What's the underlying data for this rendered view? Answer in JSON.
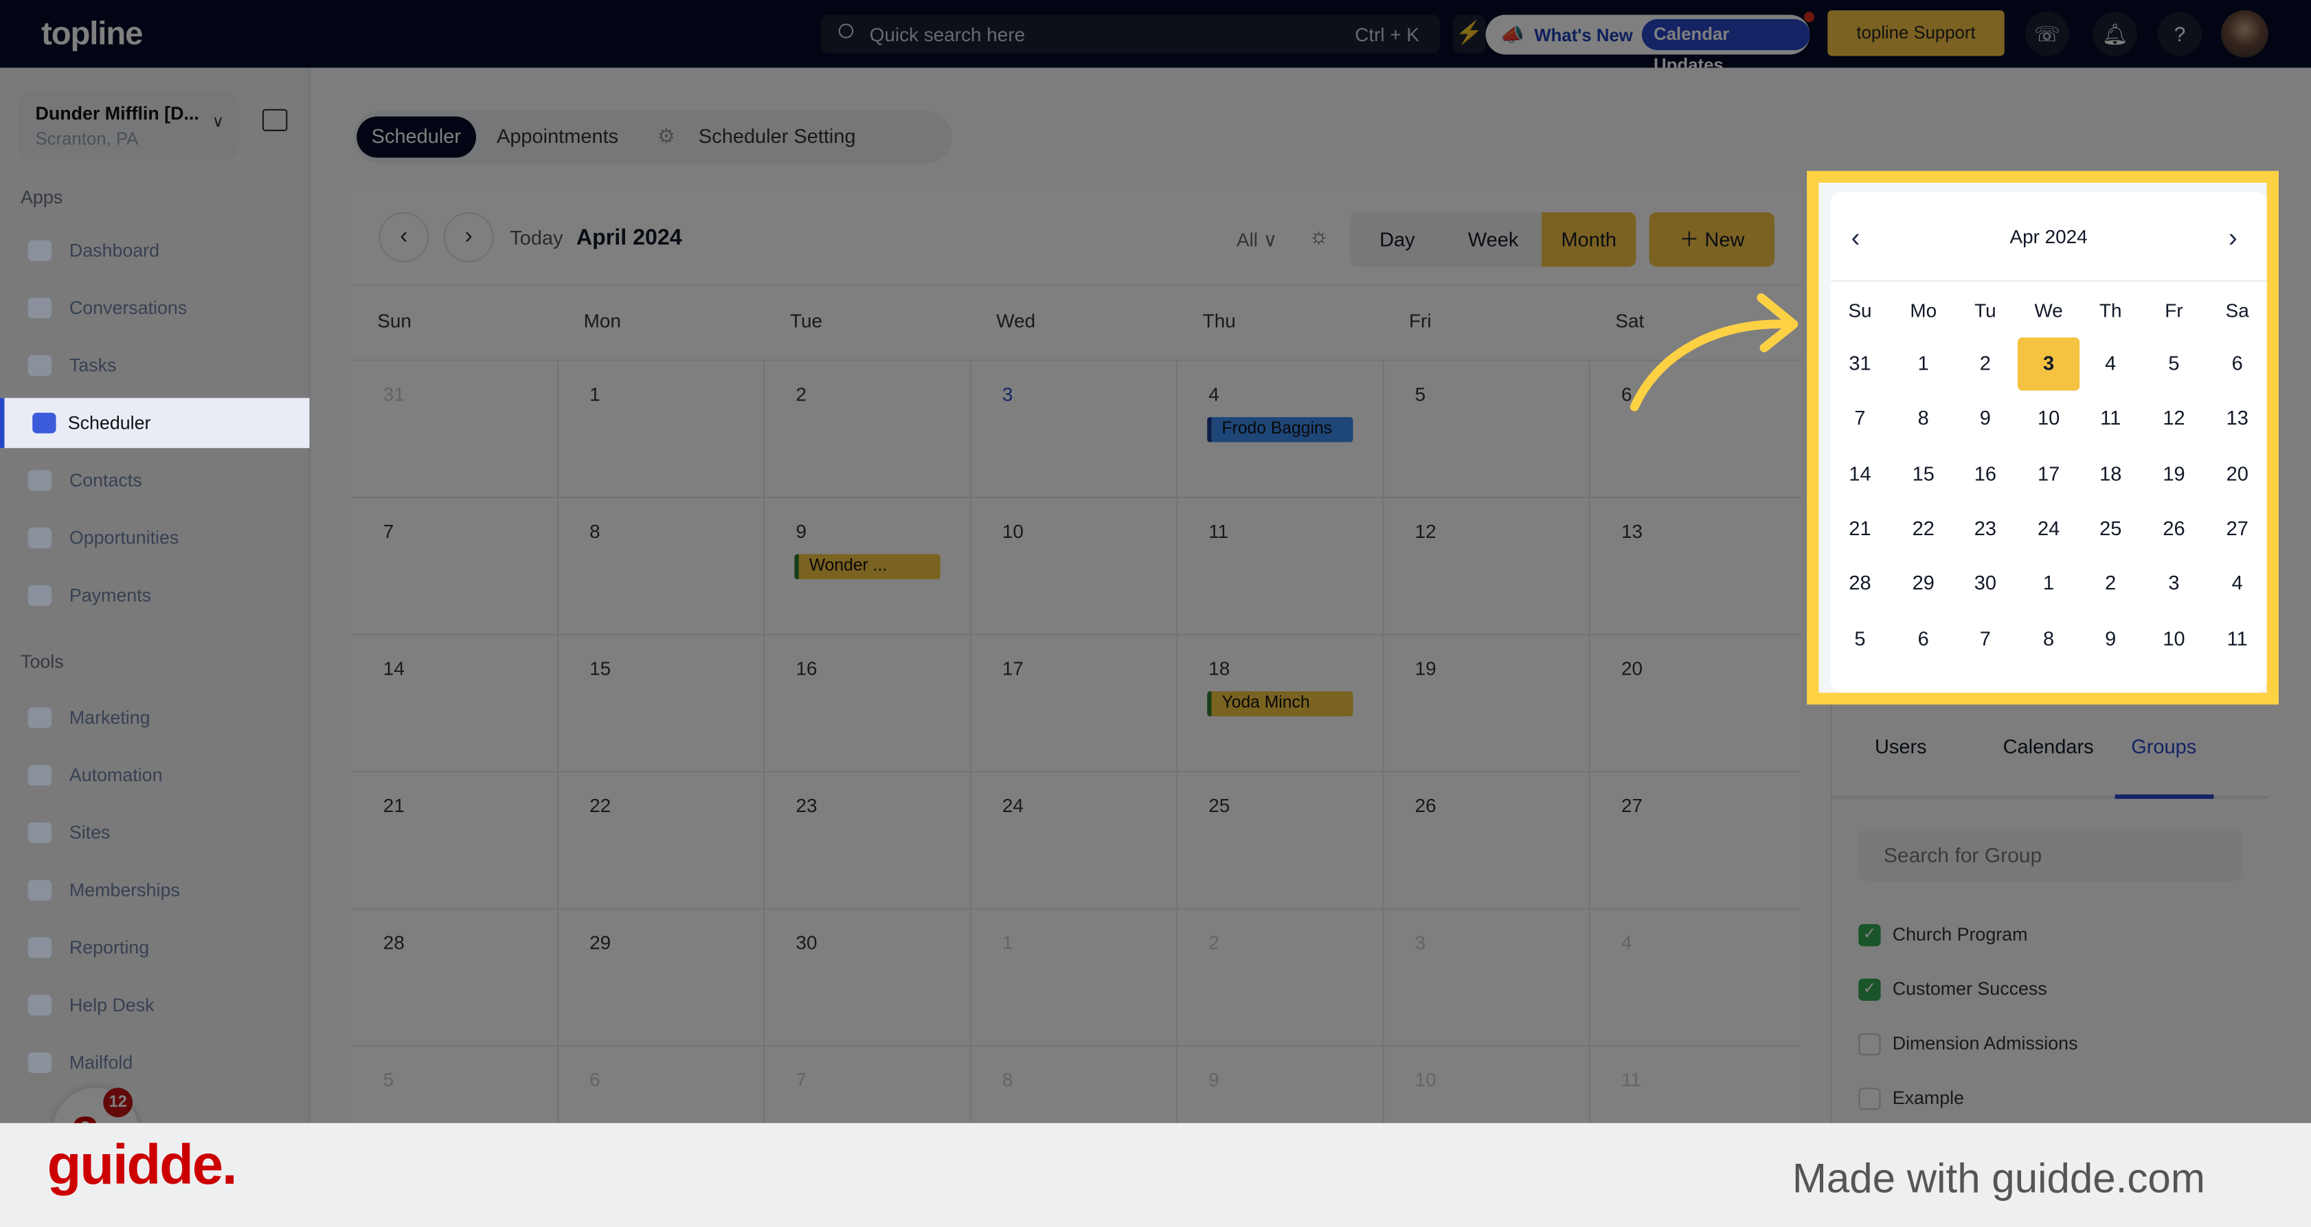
{
  "topbar": {
    "logo": "topline",
    "search_placeholder": "Quick search here",
    "search_shortcut": "Ctrl + K",
    "whats_new": "What's New",
    "calendar_updates": "Calendar Updates",
    "support": "topline Support",
    "icons": [
      "search-icon",
      "bolt-icon",
      "megaphone-icon",
      "phone-icon",
      "bell-icon",
      "help-icon",
      "avatar"
    ]
  },
  "sidebar": {
    "account_name": "Dunder Mifflin [D...",
    "account_location": "Scranton, PA",
    "apps_heading": "Apps",
    "tools_heading": "Tools",
    "apps": [
      {
        "label": "Dashboard",
        "icon": "dashboard-icon"
      },
      {
        "label": "Conversations",
        "icon": "chat-icon"
      },
      {
        "label": "Tasks",
        "icon": "tasks-icon"
      },
      {
        "label": "Scheduler",
        "icon": "calendar-icon",
        "active": true
      },
      {
        "label": "Contacts",
        "icon": "contacts-icon"
      },
      {
        "label": "Opportunities",
        "icon": "target-icon"
      },
      {
        "label": "Payments",
        "icon": "card-icon"
      }
    ],
    "tools": [
      {
        "label": "Marketing",
        "icon": "megaphone-icon"
      },
      {
        "label": "Automation",
        "icon": "gears-icon"
      },
      {
        "label": "Sites",
        "icon": "globe-icon"
      },
      {
        "label": "Memberships",
        "icon": "users-icon"
      },
      {
        "label": "Reporting",
        "icon": "pie-chart-icon"
      },
      {
        "label": "Help Desk",
        "icon": "help-icon"
      },
      {
        "label": "Mailfold",
        "icon": "mail-icon"
      }
    ],
    "chat_badge": "12"
  },
  "tabs": [
    {
      "label": "Scheduler",
      "selected": true
    },
    {
      "label": "Appointments"
    },
    {
      "label": "Scheduler Setting",
      "icon": "gear-icon"
    }
  ],
  "calendar": {
    "today": "Today",
    "title": "April 2024",
    "filter": "All",
    "views": [
      "Day",
      "Week",
      "Month"
    ],
    "selected_view": "Month",
    "new_label": "New",
    "weekdays": [
      "Sun",
      "Mon",
      "Tue",
      "Wed",
      "Thu",
      "Fri",
      "Sat"
    ],
    "weeks": [
      [
        {
          "d": "31",
          "m": 1
        },
        {
          "d": "1"
        },
        {
          "d": "2"
        },
        {
          "d": "3",
          "t": 1
        },
        {
          "d": "4"
        },
        {
          "d": "5"
        },
        {
          "d": "6"
        }
      ],
      [
        {
          "d": "7"
        },
        {
          "d": "8"
        },
        {
          "d": "9"
        },
        {
          "d": "10"
        },
        {
          "d": "11"
        },
        {
          "d": "12"
        },
        {
          "d": "13"
        }
      ],
      [
        {
          "d": "14"
        },
        {
          "d": "15"
        },
        {
          "d": "16"
        },
        {
          "d": "17"
        },
        {
          "d": "18"
        },
        {
          "d": "19"
        },
        {
          "d": "20"
        }
      ],
      [
        {
          "d": "21"
        },
        {
          "d": "22"
        },
        {
          "d": "23"
        },
        {
          "d": "24"
        },
        {
          "d": "25"
        },
        {
          "d": "26"
        },
        {
          "d": "27"
        }
      ],
      [
        {
          "d": "28"
        },
        {
          "d": "29"
        },
        {
          "d": "30"
        },
        {
          "d": "1",
          "m": 1
        },
        {
          "d": "2",
          "m": 1
        },
        {
          "d": "3",
          "m": 1
        },
        {
          "d": "4",
          "m": 1
        }
      ],
      [
        {
          "d": "5",
          "m": 1
        },
        {
          "d": "6",
          "m": 1
        },
        {
          "d": "7",
          "m": 1
        },
        {
          "d": "8",
          "m": 1
        },
        {
          "d": "9",
          "m": 1
        },
        {
          "d": "10",
          "m": 1
        },
        {
          "d": "11",
          "m": 1
        }
      ]
    ],
    "events": [
      {
        "title": "Frodo Baggins",
        "week": 0,
        "day": 4,
        "color": "#3d8ff0",
        "border": "#1b3a8a"
      },
      {
        "title": "Wonder ...",
        "week": 1,
        "day": 2,
        "color": "#f5c542",
        "border": "#2f7d32"
      },
      {
        "title": "Yoda Minch",
        "week": 2,
        "day": 4,
        "color": "#f5c542",
        "border": "#2f7d32"
      }
    ]
  },
  "mini_calendar": {
    "title": "Apr 2024",
    "weekdays": [
      "Su",
      "Mo",
      "Tu",
      "We",
      "Th",
      "Fr",
      "Sa"
    ],
    "selected": "3",
    "selected_color": "#f5c242",
    "weeks": [
      [
        "31",
        "1",
        "2",
        "3",
        "4",
        "5",
        "6"
      ],
      [
        "7",
        "8",
        "9",
        "10",
        "11",
        "12",
        "13"
      ],
      [
        "14",
        "15",
        "16",
        "17",
        "18",
        "19",
        "20"
      ],
      [
        "21",
        "22",
        "23",
        "24",
        "25",
        "26",
        "27"
      ],
      [
        "28",
        "29",
        "30",
        "1",
        "2",
        "3",
        "4"
      ],
      [
        "5",
        "6",
        "7",
        "8",
        "9",
        "10",
        "11"
      ]
    ]
  },
  "panel": {
    "tabs": [
      "Users",
      "Calendars",
      "Groups"
    ],
    "active_tab": "Groups",
    "search_placeholder": "Search for Group",
    "groups": [
      {
        "label": "Church Program",
        "checked": true
      },
      {
        "label": "Customer Success",
        "checked": true
      },
      {
        "label": "Dimension Admissions",
        "checked": false
      },
      {
        "label": "Example",
        "checked": false
      }
    ]
  },
  "colors": {
    "accent": "#2647c9",
    "highlight": "#fdd144",
    "brand_gold": "#f6c444",
    "guidde_red": "#cc0000"
  },
  "footer": {
    "brand": "guidde.",
    "made_with": "Made with guidde.com"
  }
}
